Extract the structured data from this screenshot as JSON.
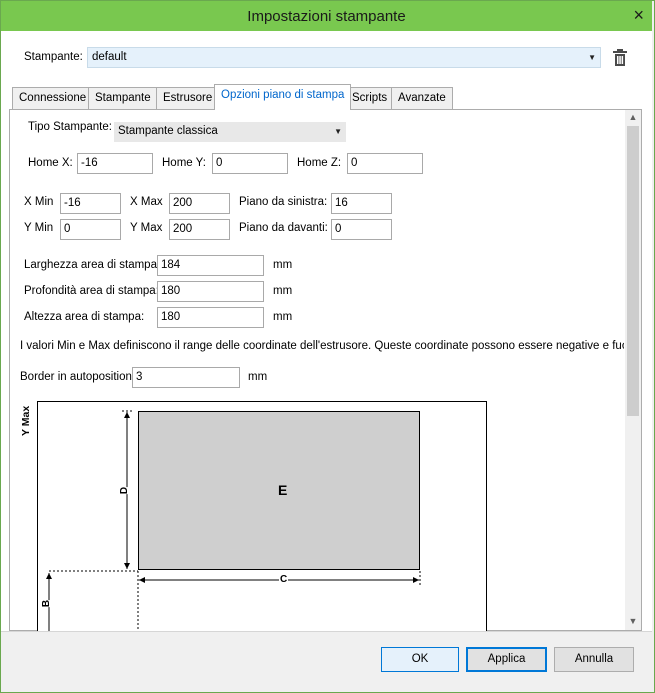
{
  "window": {
    "title": "Impostazioni stampante",
    "close_glyph": "×"
  },
  "printer": {
    "label": "Stampante:",
    "value": "default"
  },
  "tabs": [
    {
      "label": "Connessione"
    },
    {
      "label": "Stampante"
    },
    {
      "label": "Estrusore"
    },
    {
      "label": "Opzioni piano di stampa"
    },
    {
      "label": "Scripts"
    },
    {
      "label": "Avanzate"
    }
  ],
  "active_tab": "Opzioni piano di stampa",
  "form": {
    "tipo_label": "Tipo Stampante:",
    "tipo_value": "Stampante classica",
    "home_x_label": "Home X:",
    "home_x": "-16",
    "home_y_label": "Home Y:",
    "home_y": "0",
    "home_z_label": "Home Z:",
    "home_z": "0",
    "xmin_label": "X Min",
    "xmin": "-16",
    "xmax_label": "X Max",
    "xmax": "200",
    "left_label": "Piano da sinistra:",
    "left": "16",
    "ymin_label": "Y Min",
    "ymin": "0",
    "ymax_label": "Y Max",
    "ymax": "200",
    "front_label": "Piano da davanti:",
    "front": "0",
    "width_label": "Larghezza area di stampa:",
    "width": "184",
    "depth_label": "Profondità area di stampa:",
    "depth": "180",
    "height_label": "Altezza area di stampa:",
    "height": "180",
    "unit": "mm",
    "info": "I valori Min e Max definiscono il range delle coordinate dell'estrusore. Queste coordinate possono essere negative e fuori dal pian",
    "border_label": "Border in autoposition:",
    "border": "3"
  },
  "diagram": {
    "ymax_label": "Y Max",
    "area_label": "E",
    "d_label": "D",
    "c_label": "C",
    "b_label": "B"
  },
  "buttons": {
    "ok": "OK",
    "apply": "Applica",
    "cancel": "Annulla"
  },
  "icons": {
    "trash": "trash-icon",
    "dropdown": "chevron-down-icon"
  }
}
